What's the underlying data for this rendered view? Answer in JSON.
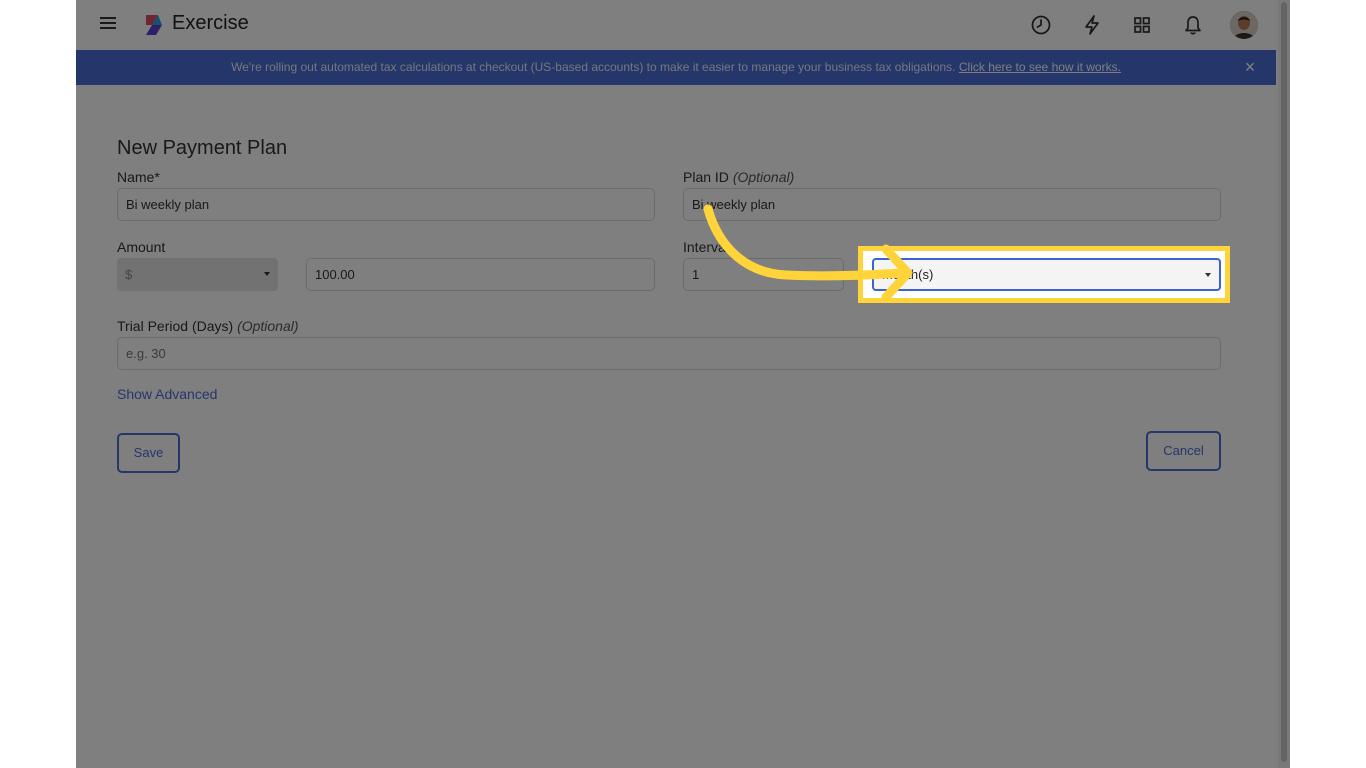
{
  "app": {
    "title": "Exercise"
  },
  "topbar": {
    "icons": [
      "menu-icon",
      "history-icon",
      "bolt-icon",
      "apps-grid-icon",
      "bell-icon",
      "avatar"
    ]
  },
  "banner": {
    "text": "We're rolling out automated tax calculations at checkout (US-based accounts) to make it easier to manage your business tax obligations. ",
    "link": "Click here to see how it works.",
    "close": "×",
    "color": "#4a6cd4"
  },
  "form": {
    "heading": "New Payment Plan",
    "name_label": "Name*",
    "name_value": "Bi weekly plan",
    "plan_id_label": "Plan ID",
    "plan_id_optional": "(Optional)",
    "plan_id_value": "Bi weekly plan",
    "amount_label": "Amount",
    "currency_value": "$",
    "amount_value": "100.00",
    "interval_label": "Interval",
    "interval_value": "1",
    "interval_unit_value": "Month(s)",
    "trial_label": "Trial Period (Days)",
    "trial_optional": "(Optional)",
    "trial_placeholder": "e.g. 30",
    "show_advanced": "Show Advanced",
    "save": "Save",
    "cancel": "Cancel"
  },
  "annotation": {
    "highlight_color": "#ffd43b"
  }
}
